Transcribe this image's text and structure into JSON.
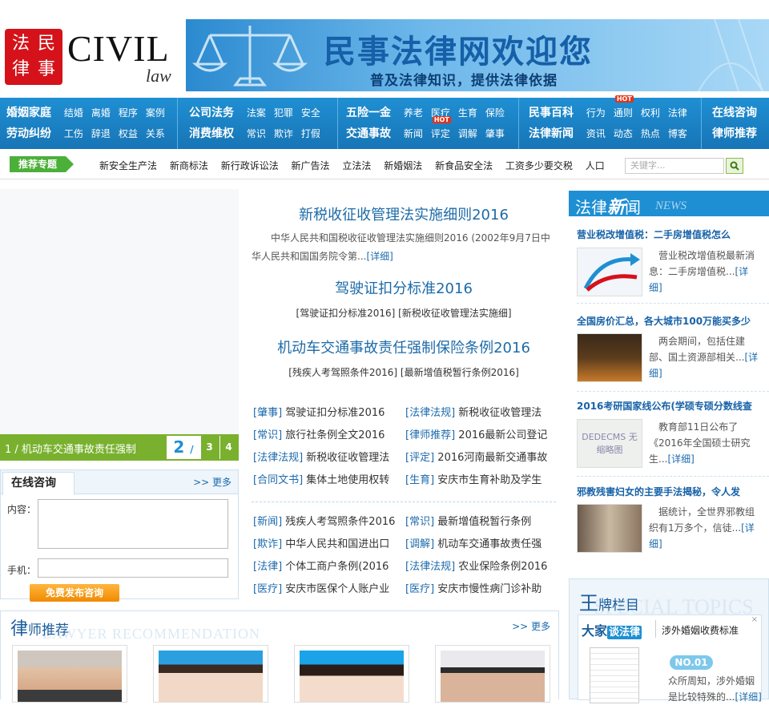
{
  "header": {
    "logo_chars": [
      "法",
      "民",
      "律",
      "事"
    ],
    "civil": "CIVIL",
    "law": "law",
    "banner_title": "民事法律网欢迎您",
    "banner_sub": "普及法律知识，提供法律依据"
  },
  "nav": [
    {
      "row1_main": "婚姻家庭",
      "row1_subs": [
        "结婚",
        "离婚",
        "程序",
        "案例"
      ],
      "row2_main": "劳动纠纷",
      "row2_subs": [
        "工伤",
        "辞退",
        "权益",
        "关系"
      ]
    },
    {
      "row1_main": "公司法务",
      "row1_subs": [
        "法案",
        "犯罪",
        "安全"
      ],
      "row2_main": "消费维权",
      "row2_subs": [
        "常识",
        "欺诈",
        "打假"
      ]
    },
    {
      "row1_main": "五险一金",
      "row1_subs": [
        "养老",
        "医疗",
        "生育",
        "保险"
      ],
      "row2_main": "交通事故",
      "row2_subs": [
        "新闻",
        "评定",
        "调解",
        "肇事"
      ]
    },
    {
      "row1_main": "民事百科",
      "row1_subs": [
        "行为",
        "通则",
        "权利",
        "法律"
      ],
      "row2_main": "法律新闻",
      "row2_subs": [
        "资讯",
        "动态",
        "热点",
        "博客"
      ]
    },
    {
      "row1_main": "在线咨询",
      "row1_subs": [],
      "row2_main": "律师推荐",
      "row2_subs": []
    }
  ],
  "hot_label": "HOT",
  "recommend": {
    "tag": "推荐专题",
    "links": [
      "新安全生产法",
      "新商标法",
      "新行政诉讼法",
      "新广告法",
      "立法法",
      "新婚姻法",
      "新食品安全法",
      "工资多少要交税",
      "人口"
    ],
    "search_placeholder": "关键字..."
  },
  "slider": {
    "caption": "1  / 机动车交通事故责任强制",
    "pages": [
      "2",
      "/",
      "3",
      "4"
    ]
  },
  "consult": {
    "title": "在线咨询",
    "more": ">> 更多",
    "content_label": "内容：",
    "phone_label": "手机：",
    "submit": "免费发布咨询"
  },
  "headlines": [
    {
      "title": "新税收征收管理法实施细则2016",
      "summary": "中华人民共和国税收征收管理法实施细则2016 (2002年9月7日中华人民共和国国务院令第...",
      "detail": "[详细]"
    },
    {
      "title": "驾驶证扣分标准2016",
      "links": "[驾驶证扣分标准2016] [新税收征收管理法实施细]"
    },
    {
      "title": "机动车交通事故责任强制保险条例2016",
      "links": "[残疾人考驾照条件2016] [最新增值税暂行条例2016]"
    }
  ],
  "list1": [
    {
      "cat": "[肇事]",
      "text": "驾驶证扣分标准2016"
    },
    {
      "cat": "[法律法规]",
      "text": "新税收征收管理法"
    },
    {
      "cat": "[常识]",
      "text": "旅行社条例全文2016"
    },
    {
      "cat": "[律师推荐]",
      "text": "2016最新公司登记"
    },
    {
      "cat": "[法律法规]",
      "text": "新税收征收管理法"
    },
    {
      "cat": "[评定]",
      "text": "2016河南最新交通事故"
    },
    {
      "cat": "[合同文书]",
      "text": "集体土地使用权转"
    },
    {
      "cat": "[生育]",
      "text": "安庆市生育补助及学生"
    }
  ],
  "list2": [
    {
      "cat": "[新闻]",
      "text": "残疾人考驾照条件2016"
    },
    {
      "cat": "[常识]",
      "text": "最新增值税暂行条例"
    },
    {
      "cat": "[欺诈]",
      "text": "中华人民共和国进出口"
    },
    {
      "cat": "[调解]",
      "text": "机动车交通事故责任强"
    },
    {
      "cat": "[法律]",
      "text": "个体工商户条例(2016"
    },
    {
      "cat": "[法律法规]",
      "text": "农业保险条例2016"
    },
    {
      "cat": "[医疗]",
      "text": "安庆市医保个人账户业"
    },
    {
      "cat": "[医疗]",
      "text": "安庆市慢性病门诊补助"
    }
  ],
  "lawyers": {
    "title_big": "律",
    "title_rest": "师推荐",
    "bg": "LAWYER RECOMMENDATION",
    "more": ">> 更多"
  },
  "news": {
    "title_a": "法律",
    "title_b": "新",
    "title_c": "闻",
    "en": "NEWS",
    "items": [
      {
        "title": "营业税改增值税：二手房增值税怎么",
        "text": "营业税改增值税最新消息：二手房增值税...",
        "detail": "[详细]"
      },
      {
        "title": "全国房价汇总，各大城市100万能买多少",
        "text": "两会期间，包括住建部、国土资源部相关...",
        "detail": "[详细]"
      },
      {
        "title": "2016考研国家线公布(学硕专硕分数线查",
        "text": "教育部11日公布了《2016年全国硕士研究生...",
        "detail": "[详细]",
        "img_text": "DEDECMS 无缩略图"
      },
      {
        "title": "邪教残害妇女的主要手法揭秘，令人发",
        "text": "据统计，全世界邪教组织有1万多个，信徒...",
        "detail": "[详细]"
      }
    ]
  },
  "wangpai": {
    "title_big": "王",
    "title_rest": "牌栏目",
    "bg": "SPECIAL TOPICS",
    "logo_a": "大家",
    "logo_b": "谈法律",
    "link": "涉外婚姻收费标准",
    "no": "NO.01",
    "text": "众所周知，涉外婚姻是比较特殊的...",
    "detail": "[详细]",
    "close": "×"
  }
}
